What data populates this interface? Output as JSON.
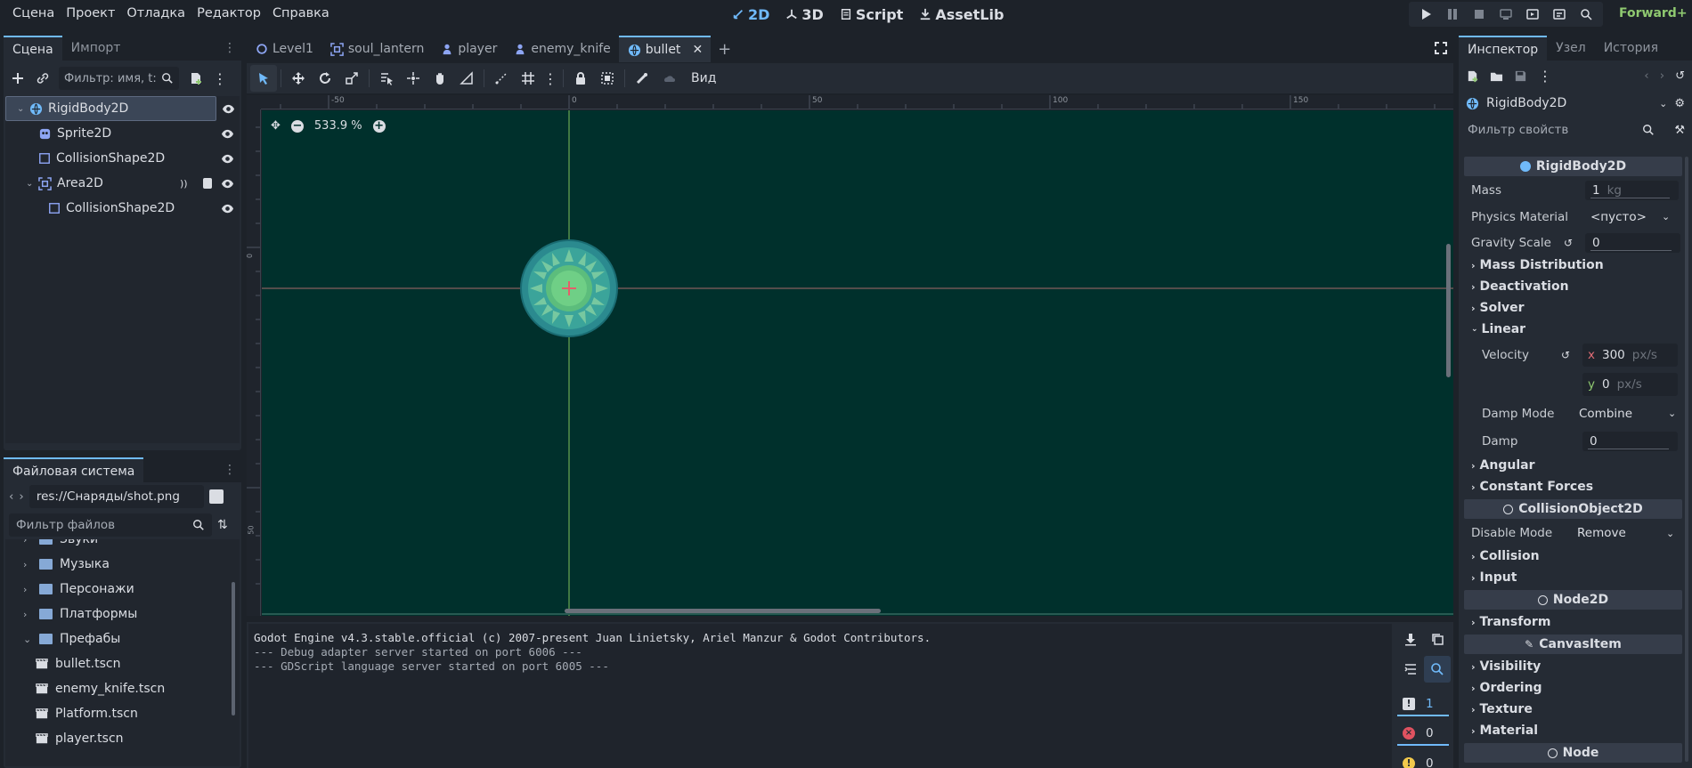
{
  "menu": [
    "Сцена",
    "Проект",
    "Отладка",
    "Редактор",
    "Справка"
  ],
  "workspaces": [
    {
      "label": "2D",
      "active": true
    },
    {
      "label": "3D",
      "active": false
    },
    {
      "label": "Script",
      "active": false
    },
    {
      "label": "AssetLib",
      "active": false
    }
  ],
  "renderer": "Forward+",
  "scene_dock": {
    "tabs": [
      "Сцена",
      "Импорт"
    ],
    "filter_placeholder": "Фильтр: имя, t:",
    "nodes": [
      {
        "label": "RigidBody2D",
        "depth": 0,
        "icon": "rigidbody-icon",
        "selected": true
      },
      {
        "label": "Sprite2D",
        "depth": 1,
        "icon": "sprite-icon"
      },
      {
        "label": "CollisionShape2D",
        "depth": 1,
        "icon": "collision-shape-icon"
      },
      {
        "label": "Area2D",
        "depth": 1,
        "icon": "area-icon"
      },
      {
        "label": "CollisionShape2D",
        "depth": 2,
        "icon": "collision-shape-icon"
      }
    ]
  },
  "filesystem": {
    "title": "Файловая система",
    "path": "res://Снаряды/shot.png",
    "filter_placeholder": "Фильтр файлов",
    "items": [
      {
        "label": "Звуки",
        "type": "folder",
        "depth": 0
      },
      {
        "label": "Музыка",
        "type": "folder",
        "depth": 0
      },
      {
        "label": "Персонажи",
        "type": "folder",
        "depth": 0
      },
      {
        "label": "Платформы",
        "type": "folder",
        "depth": 0
      },
      {
        "label": "Префабы",
        "type": "folder-open",
        "depth": 0
      },
      {
        "label": "bullet.tscn",
        "type": "scene",
        "depth": 1
      },
      {
        "label": "enemy_knife.tscn",
        "type": "scene",
        "depth": 1
      },
      {
        "label": "Platform.tscn",
        "type": "scene",
        "depth": 1
      },
      {
        "label": "player.tscn",
        "type": "scene",
        "depth": 1
      }
    ]
  },
  "scene_tabs": [
    {
      "label": "Level1",
      "icon": "node2d-icon"
    },
    {
      "label": "soul_lantern",
      "icon": "area-icon"
    },
    {
      "label": "player",
      "icon": "character-icon"
    },
    {
      "label": "enemy_knife",
      "icon": "character-icon"
    },
    {
      "label": "bullet",
      "icon": "rigidbody-icon",
      "active": true
    }
  ],
  "toolbar": {
    "view_label": "Вид"
  },
  "viewport": {
    "zoom": "533.9 %",
    "ruler_top": [
      "-50",
      "0",
      "50",
      "100",
      "150"
    ],
    "ruler_left": [
      "0",
      "50"
    ]
  },
  "console": {
    "lines": [
      "Godot Engine v4.3.stable.official (c) 2007-present Juan Linietsky, Ariel Manzur & Godot Contributors.",
      "--- Debug adapter server started on port 6006 ---",
      "--- GDScript language server started on port 6005 ---"
    ],
    "counts": [
      "1",
      "0",
      "0"
    ]
  },
  "inspector": {
    "tabs": [
      "Инспектор",
      "Узел",
      "История"
    ],
    "object": "RigidBody2D",
    "filter_placeholder": "Фильтр свойств",
    "class_header": "RigidBody2D",
    "mass_label": "Mass",
    "mass_value": "1",
    "mass_unit": "kg",
    "physics_material_label": "Physics Material",
    "physics_material_value": "<пусто>",
    "gravity_label": "Gravity Scale",
    "gravity_value": "0",
    "sections_a": [
      "Mass Distribution",
      "Deactivation",
      "Solver"
    ],
    "linear_label": "Linear",
    "velocity_label": "Velocity",
    "velocity_x": "300",
    "velocity_y": "0",
    "velocity_unit": "px/s",
    "x_label": "x",
    "y_label": "y",
    "damp_mode_label": "Damp Mode",
    "damp_mode_value": "Combine",
    "damp_label": "Damp",
    "damp_value": "0",
    "sections_b": [
      "Angular",
      "Constant Forces"
    ],
    "collision_object_header": "CollisionObject2D",
    "disable_mode_label": "Disable Mode",
    "disable_mode_value": "Remove",
    "sections_c": [
      "Collision",
      "Input"
    ],
    "node2d_header": "Node2D",
    "sections_d": [
      "Transform"
    ],
    "canvasitem_header": "CanvasItem",
    "sections_e": [
      "Visibility",
      "Ordering",
      "Texture",
      "Material"
    ],
    "node_header": "Node"
  },
  "colors": {
    "accent": "#70bafa",
    "viewport_bg": "#00302c",
    "renderer": "#8fc970"
  }
}
